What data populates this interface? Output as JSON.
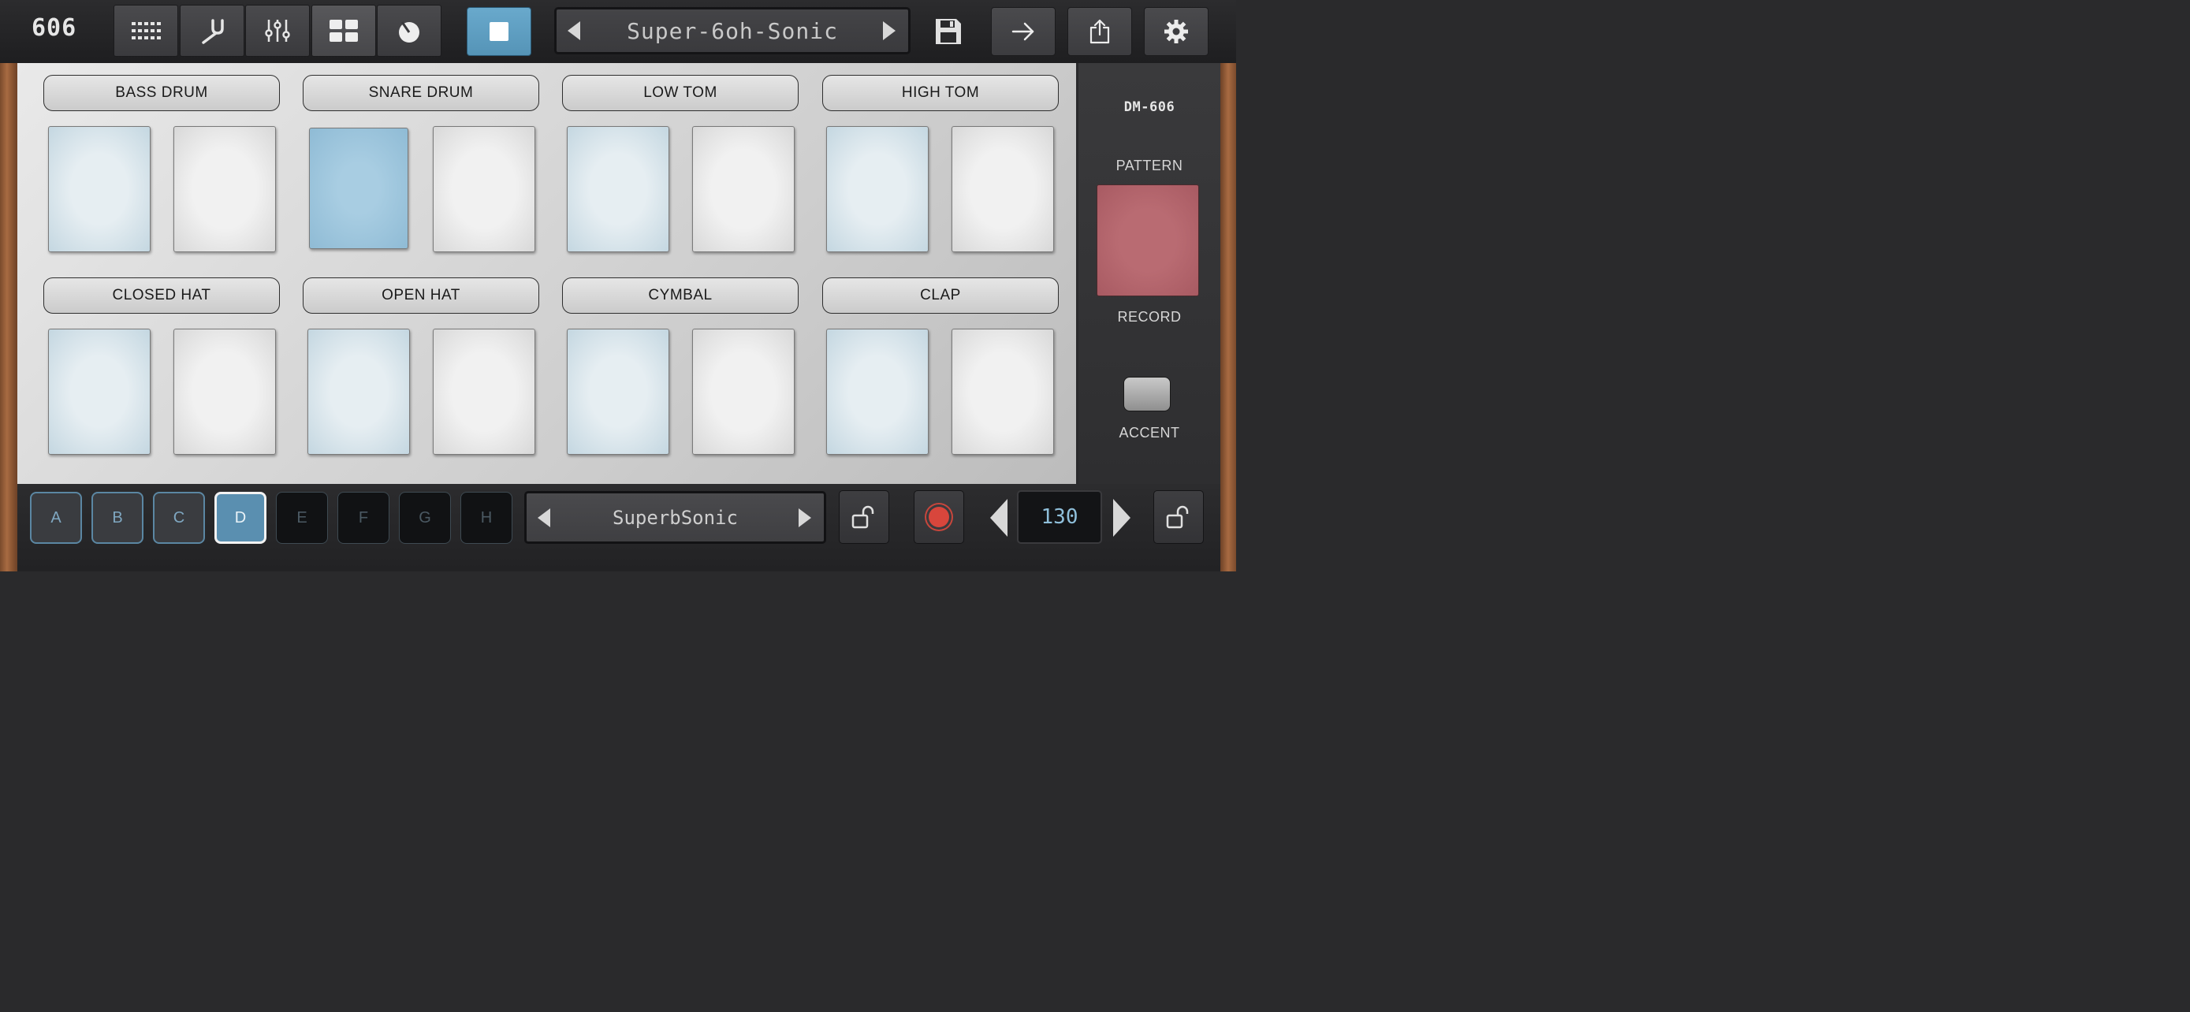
{
  "app": {
    "logo": "606",
    "model": "DM-606"
  },
  "toolbar": {
    "tabs": [
      {
        "icon": "step-grid-icon"
      },
      {
        "icon": "tuning-fork-icon"
      },
      {
        "icon": "mixer-sliders-icon"
      },
      {
        "icon": "pads-grid-icon",
        "active": true
      },
      {
        "icon": "knob-icon"
      }
    ],
    "transport": {
      "icon": "stop-icon",
      "color": "#5fa2c6"
    },
    "pattern_name": "Super-6oh-Sonic",
    "right_icons": [
      "save-icon",
      "arrow-right-icon",
      "share-icon",
      "gear-icon"
    ]
  },
  "instruments": [
    {
      "label": "BASS DRUM"
    },
    {
      "label": "SNARE DRUM"
    },
    {
      "label": "LOW TOM"
    },
    {
      "label": "HIGH TOM"
    },
    {
      "label": "CLOSED HAT"
    },
    {
      "label": "OPEN HAT"
    },
    {
      "label": "CYMBAL"
    },
    {
      "label": "CLAP"
    }
  ],
  "side": {
    "pattern_label": "PATTERN",
    "record_label": "RECORD",
    "accent_label": "ACCENT",
    "record_color": "#b4656c"
  },
  "banks": [
    "A",
    "B",
    "C",
    "D",
    "E",
    "F",
    "G",
    "H"
  ],
  "selected_bank": "D",
  "kit_name": "SuperbSonic",
  "tempo": "130",
  "colors": {
    "accent_blue": "#5a8fb0",
    "pad_lit": "#9cc4dc",
    "record_red": "#d8463c"
  }
}
